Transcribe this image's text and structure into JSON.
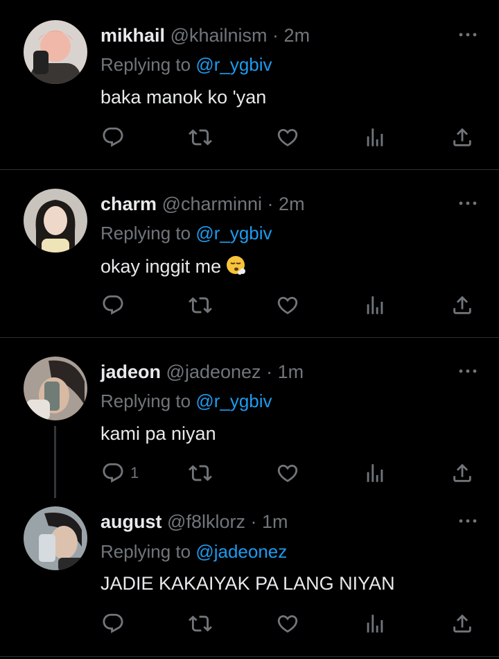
{
  "tweets": [
    {
      "name": "mikhail",
      "handle": "@khailnism",
      "dot": "·",
      "time": "2m",
      "replying_prefix": "Replying to",
      "replying_to": "@r_ygbiv",
      "text": "baka manok ko 'yan",
      "reply_count": ""
    },
    {
      "name": "charm",
      "handle": "@charminni",
      "dot": "·",
      "time": "2m",
      "replying_prefix": "Replying to",
      "replying_to": "@r_ygbiv",
      "text": "okay inggit me",
      "emoji": "😮‍💨",
      "reply_count": ""
    },
    {
      "name": "jadeon",
      "handle": "@jadeonez",
      "dot": "·",
      "time": "1m",
      "replying_prefix": "Replying to",
      "replying_to": "@r_ygbiv",
      "text": "kami pa niyan",
      "reply_count": "1"
    },
    {
      "name": "august",
      "handle": "@f8lklorz",
      "dot": "·",
      "time": "1m",
      "replying_prefix": "Replying to",
      "replying_to": "@jadeonez",
      "text": "JADIE KAKAIYAK PA LANG NIYAN",
      "reply_count": ""
    }
  ],
  "icons": {
    "reply": "reply-icon",
    "retweet": "retweet-icon",
    "like": "heart-icon",
    "views": "analytics-icon",
    "share": "share-icon",
    "more": "more-icon"
  },
  "colors": {
    "background": "#000000",
    "text": "#e7e9ea",
    "muted": "#71767b",
    "link": "#1d9bf0",
    "divider": "#2f3336"
  }
}
